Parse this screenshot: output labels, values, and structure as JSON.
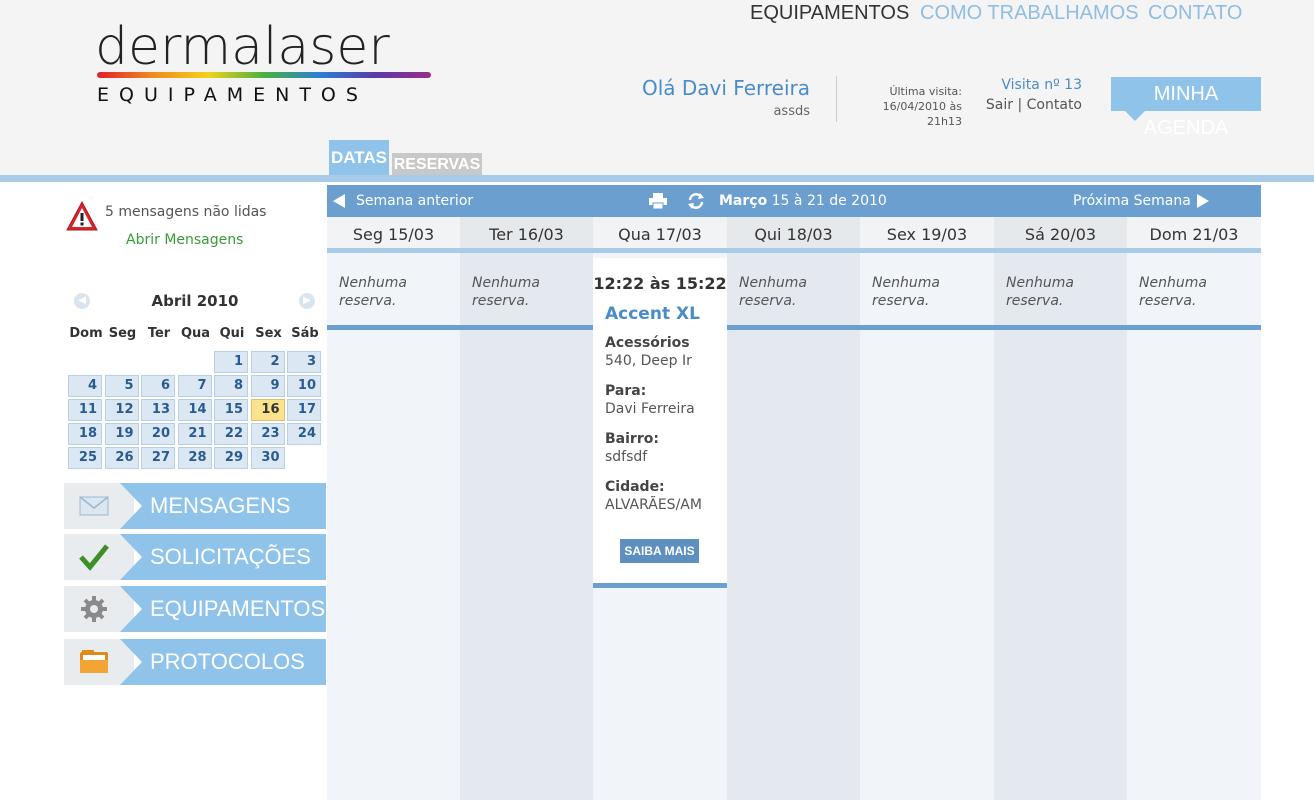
{
  "logo": {
    "word": "dermalaser",
    "sub": "EQUIPAMENTOS"
  },
  "topnav": {
    "equipamentos": "EQUIPAMENTOS",
    "como": "COMO TRABALHAMOS",
    "contato": "CONTATO"
  },
  "user": {
    "greeting": "Olá Davi Ferreira",
    "subtitle": "assds",
    "last_visit_label": "Última visita:",
    "last_visit_date": "16/04/2010 às",
    "last_visit_time": "21h13",
    "visit_count": "Visita nº 13",
    "logout": "Sair",
    "contact": "Contato",
    "separator": "|"
  },
  "agenda_button": "MINHA AGENDA",
  "tabs": {
    "datas": "DATAS",
    "reservas": "RESERVAS"
  },
  "messages": {
    "unread": "5 mensagens não lidas",
    "open": "Abrir Mensagens"
  },
  "mini_calendar": {
    "title": "Abril 2010",
    "dows": [
      "Dom",
      "Seg",
      "Ter",
      "Qua",
      "Qui",
      "Sex",
      "Sáb"
    ],
    "first_weekday": 4,
    "days": 30,
    "today": 16
  },
  "side_menu": [
    {
      "label": "MENSAGENS",
      "icon": "envelope-icon"
    },
    {
      "label": "SOLICITAÇÕES",
      "icon": "checkmark-icon"
    },
    {
      "label": "EQUIPAMENTOS",
      "icon": "gear-icon"
    },
    {
      "label": "PROTOCOLOS",
      "icon": "folder-icon"
    }
  ],
  "week": {
    "prev": "Semana anterior",
    "next": "Próxima Semana",
    "month": "Março",
    "range": " 15 à 21 de 2010",
    "days": [
      "Seg 15/03",
      "Ter 16/03",
      "Qua 17/03",
      "Qui 18/03",
      "Sex 19/03",
      "Sá 20/03",
      "Dom 21/03"
    ],
    "empty_text": "Nenhuma reserva."
  },
  "event": {
    "time": "12:22 às 15:22",
    "title": "Accent XL",
    "acessorios_label": "Acessórios",
    "acessorios_value": "540, Deep Ir",
    "para_label": "Para:",
    "para_value": "Davi Ferreira",
    "bairro_label": "Bairro:",
    "bairro_value": "sdfsdf",
    "cidade_label": "Cidade:",
    "cidade_value": "ALVARÃES/AM",
    "button": "SAIBA MAIS"
  }
}
